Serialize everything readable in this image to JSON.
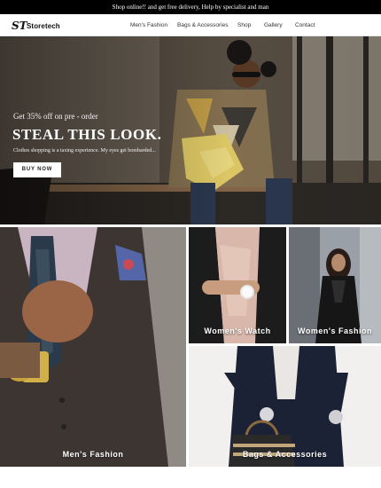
{
  "announcement": "Shop online!! and get free delivery, Help by specialist and man",
  "brand": {
    "mark": "ST",
    "name": "Storetech"
  },
  "nav": {
    "items": [
      "Men's Fashion",
      "Bags & Accessories",
      "Shop",
      "Gallery",
      "Contact"
    ]
  },
  "hero": {
    "offer": "Get 35% off on pre - order",
    "title": "STEAL THIS LOOK.",
    "subtitle": "Clothes shopping is a taxing experience. My eyes get bombarded...",
    "cta": "BUY NOW"
  },
  "tiles": {
    "mens_fashion": "Men's Fashion",
    "womens_watch": "Women's Watch",
    "womens_fashion": "Women's Fashion",
    "bags_accessories": "Bags & Accessories"
  },
  "colors": {
    "topbar": "#000000",
    "button_bg": "#ffffff",
    "label_text": "#ffffff"
  }
}
